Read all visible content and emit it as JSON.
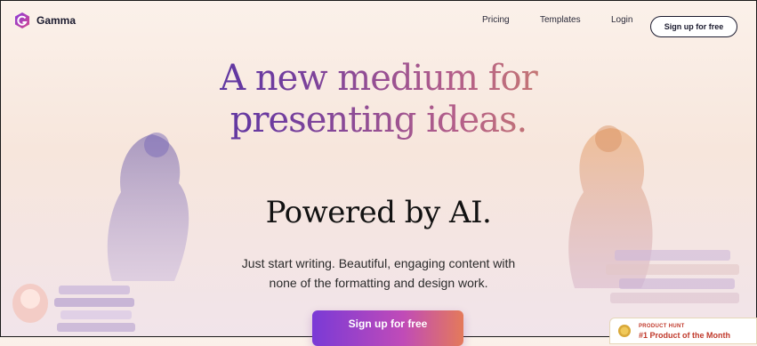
{
  "nav": {
    "brand": "Gamma",
    "links": {
      "pricing": "Pricing",
      "templates": "Templates",
      "login": "Login"
    },
    "signup": "Sign up for free"
  },
  "hero": {
    "headline_line1": "A new medium for",
    "headline_line2": "presenting ideas.",
    "subhead": "Powered by AI.",
    "body_line1": "Just start writing. Beautiful, engaging content with",
    "body_line2": "none of the formatting and design work.",
    "cta": "Sign up for free"
  },
  "badge": {
    "label": "PRODUCT HUNT",
    "title": "#1 Product of the Month"
  },
  "colors": {
    "brand_purple": "#7a3ad6",
    "headline_start": "#2a2aa8",
    "headline_end": "#d8925a",
    "badge_red": "#c0392b"
  }
}
